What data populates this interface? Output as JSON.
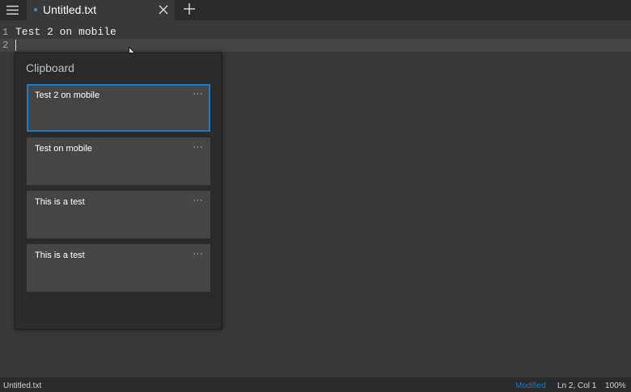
{
  "tab": {
    "title": "Untitled.txt",
    "unsaved_indicator_color": "#3a8fd8",
    "menu_icon": "hamburger-icon",
    "close_icon": "close-icon",
    "new_tab_icon": "plus-icon"
  },
  "editor": {
    "lines": [
      {
        "number": "1",
        "text": "Test 2 on mobile"
      },
      {
        "number": "2",
        "text": ""
      }
    ]
  },
  "clipboard": {
    "title": "Clipboard",
    "more_glyph": "···",
    "items": [
      {
        "text": "Test 2 on mobile",
        "selected": true
      },
      {
        "text": "Test on mobile",
        "selected": false
      },
      {
        "text": "This is a test",
        "selected": false
      },
      {
        "text": "This is a test",
        "selected": false
      }
    ]
  },
  "status": {
    "file_name": "Untitled.txt",
    "modified_label": "Modified",
    "position": "Ln 2, Col 1",
    "zoom": "100%",
    "accent": "#1b74c9"
  }
}
